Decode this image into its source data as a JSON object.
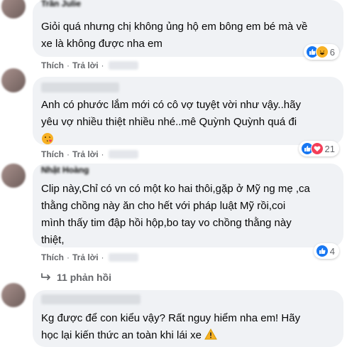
{
  "comments": [
    {
      "author": "Trần Julie",
      "text_lines": [
        "Giỏi quá nhưng chị không ủng hộ em bông em bé mà về",
        "xe là không được nha em"
      ],
      "actions": {
        "like": "Thích",
        "reply": "Trả lời"
      },
      "reaction_count": "6",
      "reactions": [
        "like-icon",
        "haha-icon"
      ]
    },
    {
      "author": "",
      "text_lines": [
        "Anh có phước lắm mới có cô vợ tuyệt vời như vậy..hãy",
        "yêu vợ nhiều thiệt nhiều nhé..mê Quỳnh Quỳnh quá đi"
      ],
      "actions": {
        "like": "Thích",
        "reply": "Trả lời"
      },
      "reaction_count": "21",
      "reactions": [
        "like-icon",
        "love-icon"
      ]
    },
    {
      "author": "Nhật Hoàng",
      "text_lines": [
        "Clip này,Chỉ có vn có một ko hai thôi,gặp ở Mỹ ng mẹ ,ca",
        "thằng chồng này ăn cho hết với pháp luật Mỹ rồi,coi",
        "mình thấy tim đập hồi hộp,bo tay vo chồng thằng này",
        "thiệt,"
      ],
      "actions": {
        "like": "Thích",
        "reply": "Trả lời"
      },
      "reaction_count": "4",
      "reactions": [
        "like-icon"
      ]
    },
    {
      "author": "",
      "text_lines": [
        "Kg được để con kiểu vậy? Rất nguy hiểm nha em! Hãy",
        "học lại kiến thức an toàn khi lái xe"
      ]
    }
  ],
  "replies_label": "11 phản hồi",
  "colors": {
    "like": "#1877f2",
    "haha": "#f7b125",
    "love": "#f33e58",
    "bubble": "#f0f2f5",
    "meta": "#65676b"
  }
}
